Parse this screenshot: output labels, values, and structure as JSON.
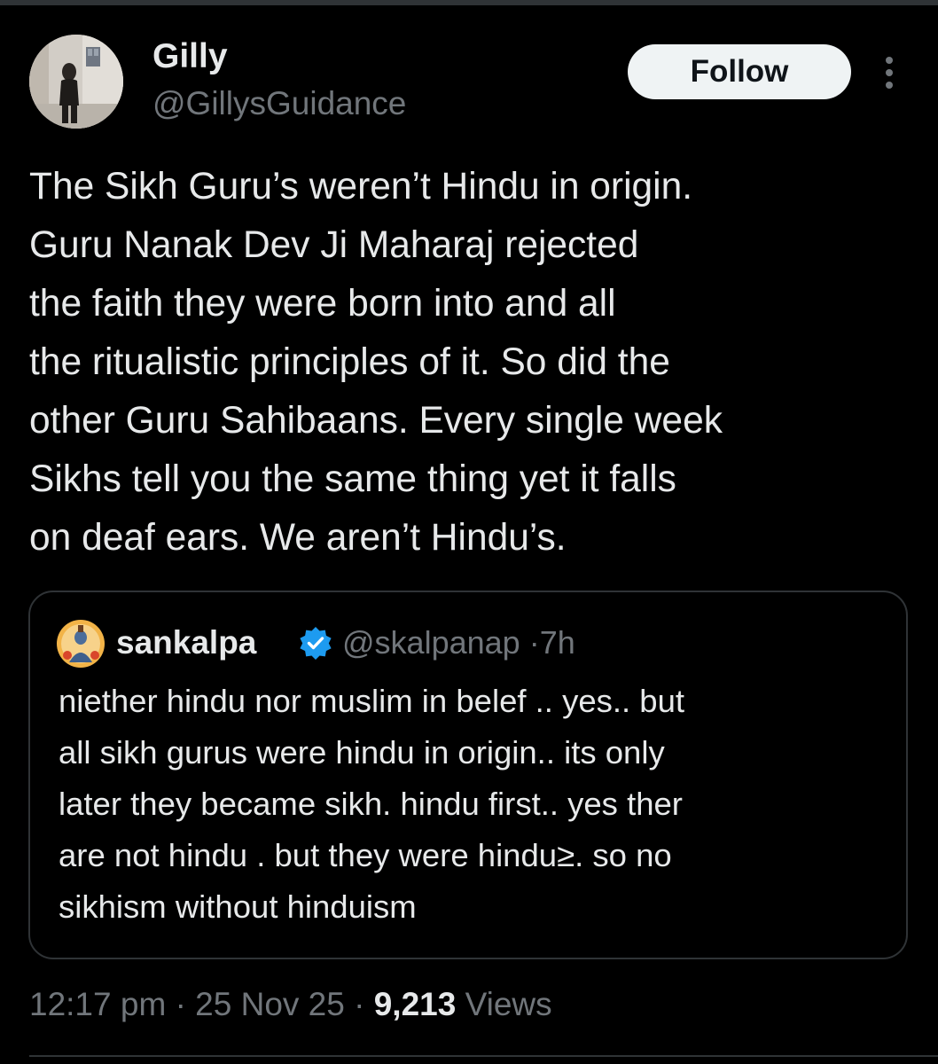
{
  "author": {
    "name": "Gilly",
    "handle": "@GillysGuidance"
  },
  "follow_label": "Follow",
  "tweet": {
    "lines": [
      "The Sikh Guru’s weren’t Hindu in origin.",
      "Guru Nanak Dev Ji Maharaj rejected",
      "the faith they were born into and all",
      "the ritualistic principles of it. So did the",
      "other Guru Sahibaans. Every single week",
      "Sikhs tell you the same thing yet it falls",
      "on deaf ears. We aren’t Hindu’s."
    ]
  },
  "quote": {
    "name": "sankalpa",
    "handle": "@skalpanap",
    "separator": "·",
    "age": "7h",
    "verified": true,
    "lines": [
      "niether hindu nor muslim in belef .. yes.. but",
      "all sikh gurus were hindu in origin.. its only",
      "later they became sikh. hindu first.. yes ther",
      "are not hindu .  but they were hindu≥. so no",
      "sikhism without hinduism"
    ]
  },
  "meta": {
    "time": "12:17 pm",
    "separator": "·",
    "date": "25 Nov 25",
    "views_count": "9,213",
    "views_label": "Views"
  },
  "colors": {
    "background": "#000000",
    "text_primary": "#e7e9ea",
    "text_secondary": "#71767b",
    "border": "#2f3336",
    "follow_bg": "#eff3f4",
    "verified_blue": "#1d9bf0"
  },
  "icons": {
    "more": "more-vertical-icon",
    "verified": "verified-badge-icon"
  }
}
